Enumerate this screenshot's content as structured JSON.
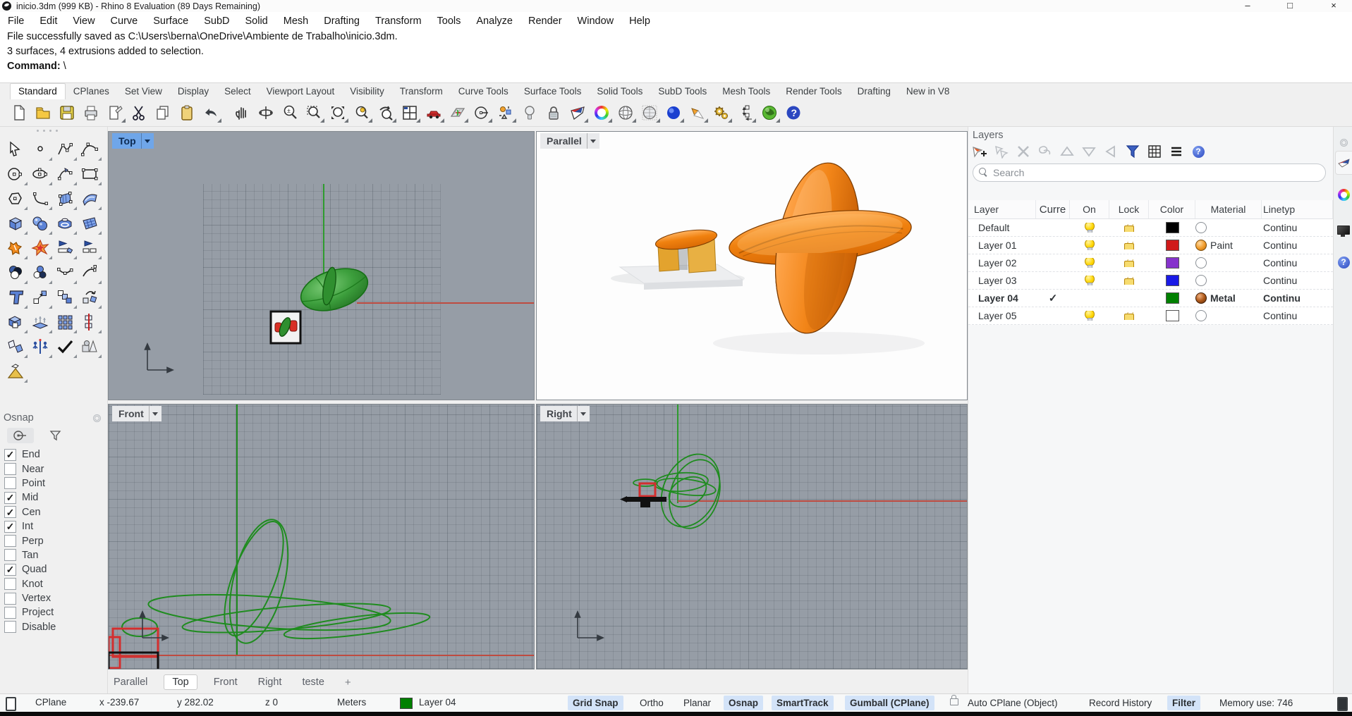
{
  "window": {
    "title": "inicio.3dm (999 KB) - Rhino 8 Evaluation (89 Days Remaining)",
    "min": "–",
    "max": "□",
    "close": "×"
  },
  "menu": {
    "items": [
      "File",
      "Edit",
      "View",
      "Curve",
      "Surface",
      "SubD",
      "Solid",
      "Mesh",
      "Drafting",
      "Transform",
      "Tools",
      "Analyze",
      "Render",
      "Window",
      "Help"
    ]
  },
  "command": {
    "history1": "File successfully saved as C:\\Users\\berna\\OneDrive\\Ambiente de Trabalho\\inicio.3dm.",
    "history2": "3 surfaces, 4 extrusions added to selection.",
    "prompt_label": "Command:",
    "prompt_value": "\\"
  },
  "ribbon": {
    "active": "Standard",
    "tabs": [
      "Standard",
      "CPlanes",
      "Set View",
      "Display",
      "Select",
      "Viewport Layout",
      "Visibility",
      "Transform",
      "Curve Tools",
      "Surface Tools",
      "Solid Tools",
      "SubD Tools",
      "Mesh Tools",
      "Render Tools",
      "Drafting",
      "New in V8"
    ]
  },
  "toolbar": {
    "icons": [
      "new-file",
      "open-file",
      "save",
      "print",
      "notes",
      "cut",
      "copy",
      "paste",
      "undo",
      "pan",
      "rotate-view",
      "zoom-dynamic",
      "zoom-window",
      "zoom-extents",
      "zoom-selected",
      "undo-view",
      "viewport-layout",
      "car",
      "cplane",
      "named-cplane",
      "osnap-settings",
      "lamp",
      "lock",
      "shaded-display",
      "rendered-display",
      "wireframe-display",
      "ghosted-display",
      "render",
      "spotlight",
      "options",
      "dimension",
      "globe",
      "help"
    ]
  },
  "sidebar": {
    "tools": [
      "select",
      "point",
      "polyline",
      "curve",
      "circle",
      "ellipse",
      "arc",
      "rectangle",
      "polygon",
      "fillet-curves",
      "surface-corner-points",
      "surface-from-curves",
      "box",
      "sphere",
      "revolve",
      "surface-grid",
      "explode",
      "explode-burst",
      "trim",
      "split",
      "boolean-union",
      "boolean-difference",
      "blend-curves",
      "extend-curve",
      "text",
      "move",
      "copy",
      "rotate",
      "solid-union",
      "extrude",
      "array-rectangular",
      "array-linear",
      "mirror",
      "orient",
      "check-selection",
      "primitives",
      "paint-pyramid"
    ]
  },
  "osnap": {
    "title": "Osnap",
    "items": [
      {
        "label": "End",
        "mark": "✓"
      },
      {
        "label": "Near",
        "mark": ""
      },
      {
        "label": "Point",
        "mark": ""
      },
      {
        "label": "Mid",
        "mark": "✓"
      },
      {
        "label": "Cen",
        "mark": "✓"
      },
      {
        "label": "Int",
        "mark": "✓"
      },
      {
        "label": "Perp",
        "mark": ""
      },
      {
        "label": "Tan",
        "mark": ""
      },
      {
        "label": "Quad",
        "mark": "✓"
      },
      {
        "label": "Knot",
        "mark": ""
      },
      {
        "label": "Vertex",
        "mark": ""
      },
      {
        "label": "Project",
        "mark": ""
      },
      {
        "label": "Disable",
        "mark": ""
      }
    ]
  },
  "viewports": {
    "top": {
      "label": "Top",
      "axis_v": "y",
      "axis_h": "x"
    },
    "parallel": {
      "label": "Parallel"
    },
    "front": {
      "label": "Front",
      "axis_v": "z",
      "axis_h": "x"
    },
    "right": {
      "label": "Right",
      "axis_v": "z",
      "axis_h": "y"
    }
  },
  "viewport_tabs": {
    "items": [
      "Parallel",
      "Top",
      "Front",
      "Right",
      "teste"
    ],
    "active": "Top",
    "add": "+"
  },
  "layers": {
    "title": "Layers",
    "search_placeholder": "Search",
    "columns": [
      "Layer",
      "Curre",
      "On",
      "Lock",
      "Color",
      "Material",
      "Linetyp"
    ],
    "rows": [
      {
        "name": "Default",
        "current": "",
        "on": true,
        "lock": true,
        "color": "#000000",
        "material": "",
        "linetype": "Continu",
        "bold": false
      },
      {
        "name": "Layer 01",
        "current": "",
        "on": true,
        "lock": true,
        "color": "#D01A1A",
        "material": "Paint",
        "linetype": "Continu",
        "bold": false
      },
      {
        "name": "Layer 02",
        "current": "",
        "on": true,
        "lock": true,
        "color": "#8633CC",
        "material": "",
        "linetype": "Continu",
        "bold": false
      },
      {
        "name": "Layer 03",
        "current": "",
        "on": true,
        "lock": true,
        "color": "#1A1AE6",
        "material": "",
        "linetype": "Continu",
        "bold": false
      },
      {
        "name": "Layer 04",
        "current": "✓",
        "on": false,
        "lock": false,
        "color": "#008000",
        "material": "Metal",
        "linetype": "Continu",
        "bold": true
      },
      {
        "name": "Layer 05",
        "current": "",
        "on": true,
        "lock": true,
        "color": "#FFFFFF",
        "material": "",
        "linetype": "Continu",
        "bold": false
      }
    ]
  },
  "status": {
    "cplane": "CPlane",
    "x": "x -239.67",
    "y": "y 282.02",
    "z": "z 0",
    "units": "Meters",
    "layer": "Layer 04",
    "layer_color": "#008000",
    "toggles": [
      {
        "label": "Grid Snap",
        "active": true
      },
      {
        "label": "Ortho",
        "active": false
      },
      {
        "label": "Planar",
        "active": false
      },
      {
        "label": "Osnap",
        "active": true
      },
      {
        "label": "SmartTrack",
        "active": true
      },
      {
        "label": "Gumball (CPlane)",
        "active": true
      },
      {
        "label": "Auto CPlane (Object)",
        "active": false
      },
      {
        "label": "Record History",
        "active": false
      },
      {
        "label": "Filter",
        "active": true
      },
      {
        "label": "Memory use: 746",
        "active": false
      }
    ]
  },
  "glyphs": {
    "help": "?"
  }
}
